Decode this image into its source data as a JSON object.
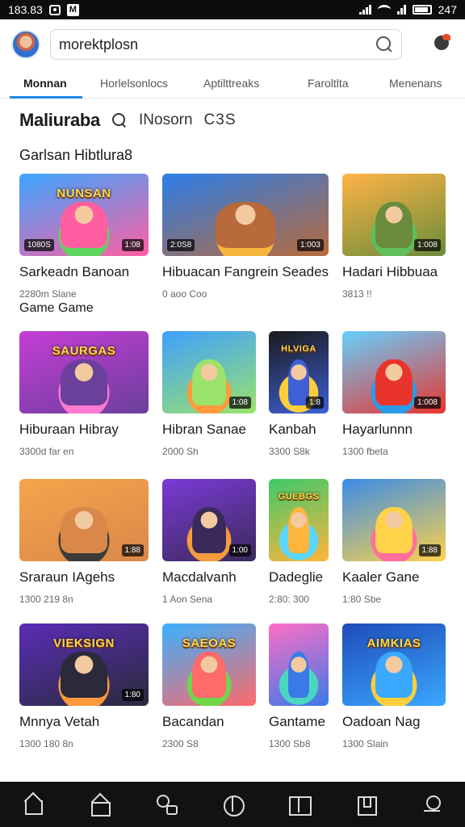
{
  "status_bar": {
    "time": "183.83",
    "battery_text": "247"
  },
  "search": {
    "value": "morektplosn"
  },
  "tabs": [
    {
      "label": "Monnan"
    },
    {
      "label": "Horlelsonlocs"
    },
    {
      "label": "Aptilttreaks"
    },
    {
      "label": "Faroltlta"
    },
    {
      "label": "Menenans"
    }
  ],
  "section": {
    "title": "Maliuraba",
    "sub": "INosorn",
    "badge": "C3S"
  },
  "subheading": "Garlsan Hibtlura8",
  "games": [
    {
      "thumb_title": "NUNSAN",
      "badge": "1:08",
      "badge_left": "1080S",
      "title": "Sarkeadn Banoan",
      "meta": "2280m Slane",
      "extra": "Game Game",
      "colors": [
        "#3ba6ff",
        "#5cd65c",
        "#ff5fa2"
      ]
    },
    {
      "thumb_title": "",
      "badge": "1:003",
      "badge_left": "2:0S8",
      "title": "Hibuacan Fangrein Seades",
      "meta": "0 aoo Coo",
      "extra": "",
      "colors": [
        "#2b7de9",
        "#f5b63c",
        "#b86a3a"
      ]
    },
    {
      "thumb_title": "",
      "badge": "1:008",
      "badge_left": "",
      "title": "Hadari Hibbuaa",
      "meta": "3813 !!",
      "extra": "",
      "colors": [
        "#ffb347",
        "#5fbf5a",
        "#6a8c3a"
      ]
    },
    {
      "thumb_title": "SAURGAS",
      "badge": "",
      "badge_left": "",
      "title": "Hiburaan Hibray",
      "meta": "3300d far en",
      "extra": "",
      "colors": [
        "#c63dd6",
        "#ff7ad1",
        "#6b3f9c"
      ]
    },
    {
      "thumb_title": "",
      "badge": "1:08",
      "badge_left": "",
      "title": "Hibran Sanae",
      "meta": "2000 Sh",
      "extra": "",
      "colors": [
        "#3ea0ff",
        "#ff9a3c",
        "#9be36b"
      ]
    },
    {
      "thumb_title": "HLVIGA",
      "badge": "1:8",
      "badge_left": "",
      "title": "Kanbah",
      "meta": "3300 S8k",
      "extra": "",
      "colors": [
        "#1a1a1a",
        "#ffcf3b",
        "#3e5fd6"
      ]
    },
    {
      "thumb_title": "",
      "badge": "1:008",
      "badge_left": "",
      "title": "Hayarlunnn",
      "meta": "1300 fbeta",
      "extra": "",
      "colors": [
        "#66d0ff",
        "#2b9be8",
        "#e9342e"
      ]
    },
    {
      "thumb_title": "",
      "badge": "1:88",
      "badge_left": "",
      "title": "Sraraun IAgehs",
      "meta": "1300 219 8n",
      "extra": "",
      "colors": [
        "#f5a54a",
        "#3a3a3a",
        "#d9884a"
      ]
    },
    {
      "thumb_title": "",
      "badge": "1:00",
      "badge_left": "",
      "title": "Macdalvanh",
      "meta": "1 Aon Sena",
      "extra": "",
      "colors": [
        "#7b3ad6",
        "#f59b3c",
        "#3a2a5a"
      ]
    },
    {
      "thumb_title": "GUEBGS",
      "badge": "",
      "badge_left": "",
      "title": "Dadeglie",
      "meta": "2:80: 300",
      "extra": "",
      "colors": [
        "#3ec96a",
        "#5bd6ff",
        "#ffb43c"
      ]
    },
    {
      "thumb_title": "",
      "badge": "1:88",
      "badge_left": "",
      "title": "Kaaler Gane",
      "meta": "1:80 Sbe",
      "extra": "",
      "colors": [
        "#3a8ce8",
        "#ff6e9c",
        "#ffd24a"
      ]
    },
    {
      "thumb_title": "VIEKSIGN",
      "badge": "1:80",
      "badge_left": "",
      "title": "Mnnya Vetah",
      "meta": "1300 180 8n",
      "extra": "",
      "colors": [
        "#5a2db8",
        "#ff9a3c",
        "#2a2a3a"
      ]
    },
    {
      "thumb_title": "SAEOAS",
      "badge": "",
      "badge_left": "",
      "title": "Bacandan",
      "meta": "2300 S8",
      "extra": "",
      "colors": [
        "#3ab0ff",
        "#6fd64a",
        "#ff6a6a"
      ]
    },
    {
      "thumb_title": "",
      "badge": "",
      "badge_left": "",
      "title": "Gantame",
      "meta": "1300 Sb8",
      "extra": "",
      "colors": [
        "#ff6ec7",
        "#4ad6c0",
        "#3a7ae8"
      ]
    },
    {
      "thumb_title": "AIMKIAS",
      "badge": "",
      "badge_left": "",
      "title": "Oadoan Nag",
      "meta": "1300 Slain",
      "extra": "",
      "colors": [
        "#1e4bb8",
        "#ffcf3b",
        "#3aa8ff"
      ]
    }
  ],
  "bottom_nav": [
    {
      "icon": "home-icon"
    },
    {
      "icon": "house-icon"
    },
    {
      "icon": "search-icon"
    },
    {
      "icon": "compass-icon"
    },
    {
      "icon": "book-icon"
    },
    {
      "icon": "bookmark-icon"
    },
    {
      "icon": "profile-icon"
    }
  ]
}
